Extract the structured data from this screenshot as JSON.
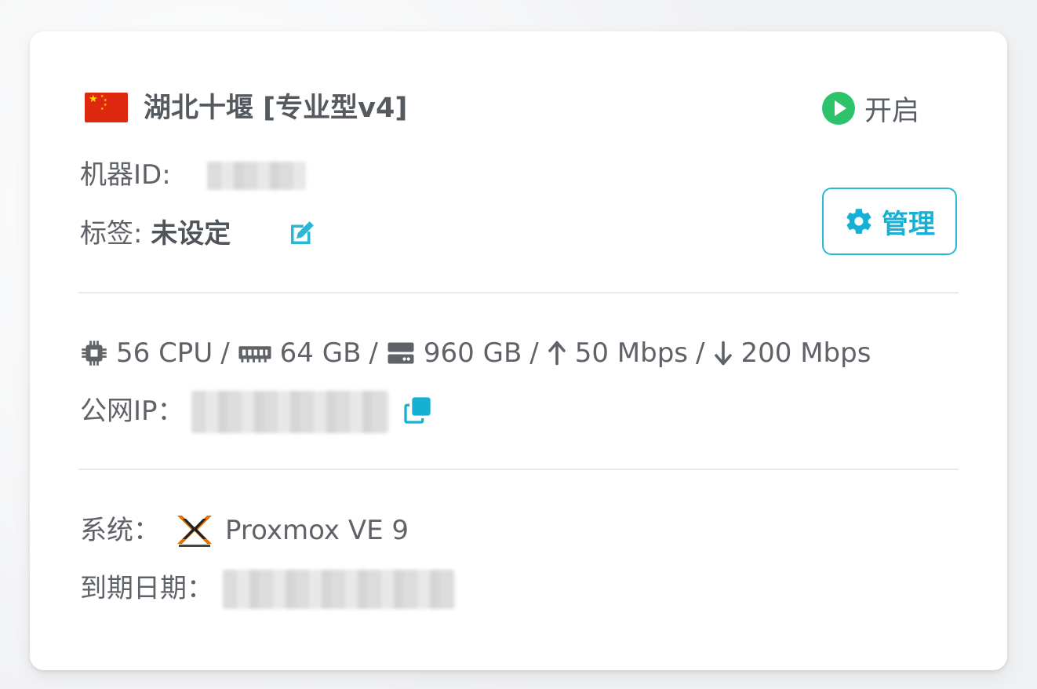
{
  "card": {
    "title": "湖北十堰 [专业型v4]",
    "status_label": "开启",
    "machine_id_label": "机器ID:",
    "tag_label": "标签:",
    "tag_value": "未设定",
    "manage_label": "管理",
    "specs": {
      "cpu": "56 CPU",
      "ram": "64 GB",
      "disk": "960 GB",
      "upload": "50 Mbps",
      "download": "200 Mbps",
      "separator": "/"
    },
    "public_ip_label": "公网IP：",
    "os_label": "系统：",
    "os_value": "Proxmox VE 9",
    "expiry_label": "到期日期："
  },
  "colors": {
    "accent": "#16b0d4",
    "status_green": "#2cc36b",
    "flag_red": "#de2910",
    "flag_yellow": "#ffde00"
  },
  "icons": {
    "flag": "china-flag-icon",
    "status": "play-circle-icon",
    "edit": "edit-icon",
    "manage": "gear-icon",
    "cpu": "cpu-icon",
    "ram": "memory-icon",
    "disk": "disk-icon",
    "upload": "arrow-up-icon",
    "download": "arrow-down-icon",
    "copy": "copy-icon",
    "os": "proxmox-logo-icon"
  }
}
